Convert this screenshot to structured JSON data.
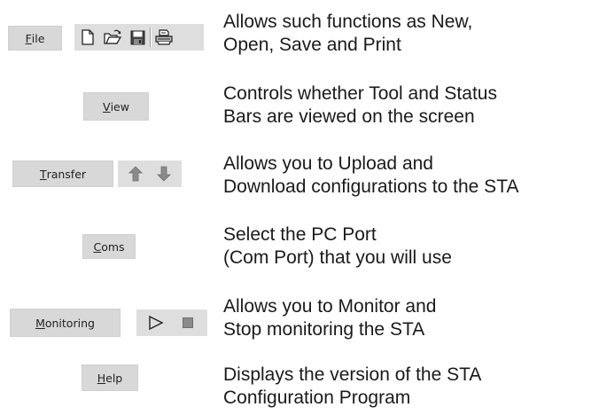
{
  "rows": [
    {
      "menu": {
        "label": "File",
        "underline": "F",
        "rest": "ile"
      },
      "toolbar_icons": [
        "new-document-icon",
        "open-folder-icon",
        "save-disk-icon",
        "print-icon"
      ],
      "description": [
        "Allows such functions as New,",
        "Open, Save and Print"
      ]
    },
    {
      "menu": {
        "label": "View",
        "underline": "V",
        "rest": "iew"
      },
      "toolbar_icons": [],
      "description": [
        "Controls whether Tool and Status",
        "Bars are viewed on the screen"
      ]
    },
    {
      "menu": {
        "label": "Transfer",
        "underline": "T",
        "rest": "ransfer"
      },
      "toolbar_icons": [
        "upload-arrow-icon",
        "download-arrow-icon"
      ],
      "description": [
        "Allows you to Upload and",
        "Download configurations to the STA"
      ]
    },
    {
      "menu": {
        "label": "Coms",
        "underline": "C",
        "rest": "oms"
      },
      "toolbar_icons": [],
      "description": [
        "Select the PC Port",
        "(Com Port) that you will use"
      ]
    },
    {
      "menu": {
        "label": "Monitoring",
        "underline": "M",
        "rest": "onitoring"
      },
      "toolbar_icons": [
        "play-icon",
        "stop-icon"
      ],
      "description": [
        "Allows you to Monitor and",
        "Stop monitoring the STA"
      ]
    },
    {
      "menu": {
        "label": "Help",
        "underline": "H",
        "rest": "elp"
      },
      "toolbar_icons": [],
      "description": [
        "Displays the version of the STA",
        "Configuration Program"
      ]
    }
  ],
  "colors": {
    "button_bg": "#d8d8d8",
    "toolbar_bg": "#dedede",
    "arrow_gray": "#8a8a8a",
    "text": "#1a1a1a"
  }
}
